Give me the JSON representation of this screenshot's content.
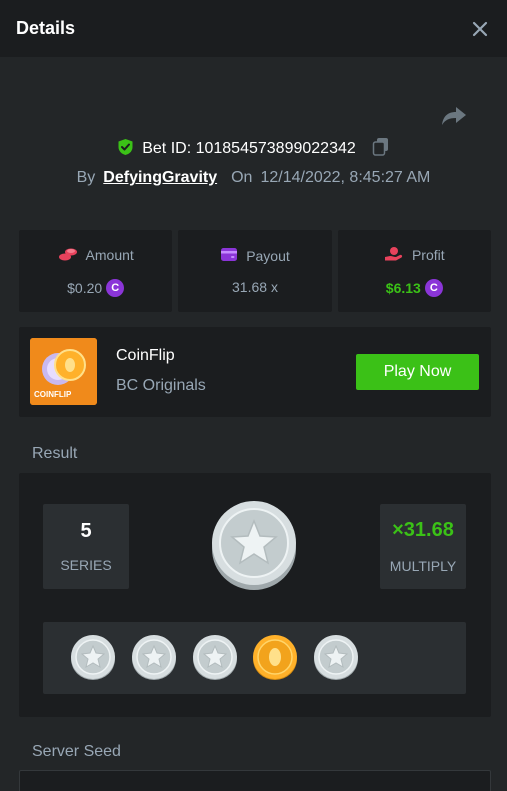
{
  "header": {
    "title": "Details"
  },
  "bet": {
    "id_label": "Bet ID: 101854573899022342",
    "by_label": "By",
    "username": "DefyingGravity",
    "on_label": "On",
    "timestamp": "12/14/2022, 8:45:27 AM"
  },
  "stats": {
    "amount": {
      "label": "Amount",
      "value": "$0.20"
    },
    "payout": {
      "label": "Payout",
      "value": "31.68 x"
    },
    "profit": {
      "label": "Profit",
      "value": "$6.13"
    }
  },
  "game": {
    "name": "CoinFlip",
    "provider": "BC Originals",
    "thumb_label": "COINFLIP",
    "play_label": "Play Now"
  },
  "result": {
    "section_label": "Result",
    "series_value": "5",
    "series_label": "SERIES",
    "multiply_value": "×31.68",
    "multiply_label": "MULTIPLY",
    "history": [
      "silver",
      "silver",
      "silver",
      "gold",
      "silver"
    ]
  },
  "server_seed": {
    "label": "Server Seed"
  },
  "colors": {
    "accent_green": "#3bc117",
    "coin_purple": "#8b35d8",
    "panel": "#1b1d1f",
    "background": "#232628",
    "muted_text": "#98a7b5"
  },
  "icons": {
    "close": "close-icon",
    "share": "share-icon",
    "verified": "shield-check-icon",
    "copy": "copy-icon",
    "amount": "coins-icon",
    "payout": "wallet-icon",
    "profit": "hand-coin-icon",
    "currency": "coin-currency-icon"
  }
}
